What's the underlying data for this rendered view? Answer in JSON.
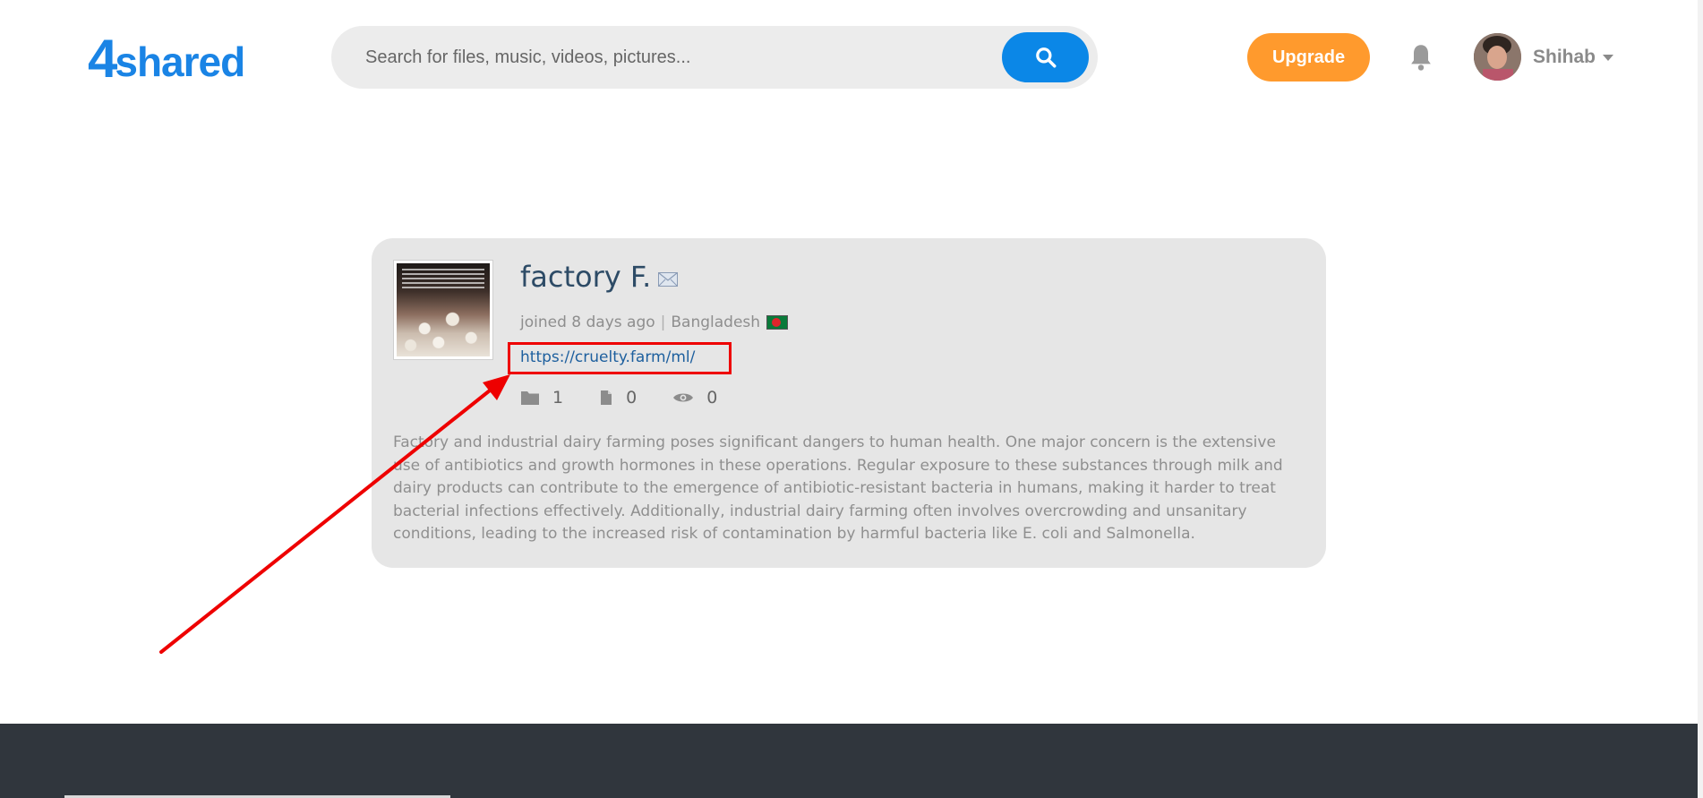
{
  "header": {
    "logo_digit": "4",
    "logo_word": "shared",
    "search_placeholder": "Search for files, music, videos, pictures...",
    "upgrade_label": "Upgrade",
    "user_name": "Shihab"
  },
  "profile": {
    "name": "factory F.",
    "joined": "joined 8 days ago",
    "separator": "|",
    "country": "Bangladesh",
    "link": "https://cruelty.farm/ml/",
    "stats": {
      "folders": "1",
      "files": "0",
      "views": "0"
    },
    "description": "Factory and industrial dairy farming poses significant dangers to human health. One major concern is the extensive use of antibiotics and growth hormones in these operations. Regular exposure to these substances through milk and dairy products can contribute to the emergence of antibiotic-resistant bacteria in humans, making it harder to treat bacterial infections effectively. Additionally, industrial dairy farming often involves overcrowding and unsanitary conditions, leading to the increased risk of contamination by harmful bacteria like E. coli and Salmonella."
  },
  "colors": {
    "brand_blue": "#1a84e5",
    "search_button": "#0b87e7",
    "upgrade": "#ff9a2d",
    "link": "#1d5f9e",
    "highlight": "#ee0000",
    "footer": "#30363d"
  },
  "icons": {
    "search": "search-icon",
    "bell": "bell-icon",
    "mail": "mail-icon",
    "folder": "folder-icon",
    "file": "file-icon",
    "eye": "eye-icon"
  }
}
